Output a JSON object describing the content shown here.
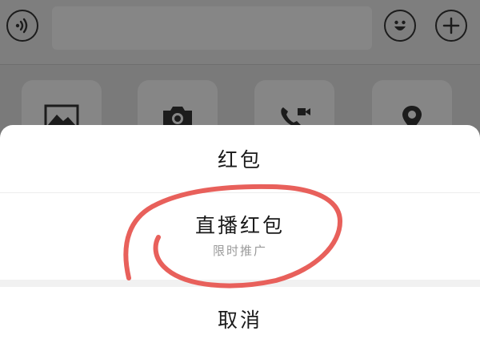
{
  "background": {
    "icons": {
      "voice": "voice-icon",
      "emoji": "emoji-icon",
      "add": "plus-icon",
      "tiles": [
        "image-icon",
        "camera-icon",
        "video-call-icon",
        "location-icon"
      ]
    }
  },
  "action_sheet": {
    "options": [
      {
        "label": "红包"
      },
      {
        "label": "直播红包",
        "sublabel": "限时推广"
      }
    ],
    "cancel_label": "取消"
  },
  "colors": {
    "overlay_dim": "#7a7a7a",
    "sheet_bg": "#ffffff",
    "sublabel": "#9a9a9a",
    "annotation_stroke": "#e8605b"
  }
}
